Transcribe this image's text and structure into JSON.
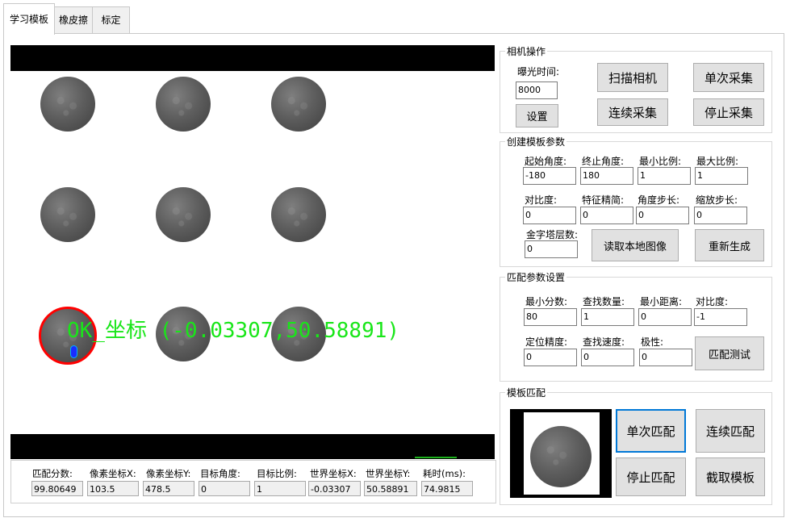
{
  "tabs": [
    "学习模板",
    "橡皮擦",
    "标定"
  ],
  "overlay": {
    "text": "OK_坐标 (-0.03307,50.58891)"
  },
  "results": {
    "labels": [
      "匹配分数:",
      "像素坐标X:",
      "像素坐标Y:",
      "目标角度:",
      "目标比例:",
      "世界坐标X:",
      "世界坐标Y:",
      "耗时(ms):"
    ],
    "values": [
      "99.80649",
      "103.5",
      "478.5",
      "0",
      "1",
      "-0.03307",
      "50.58891",
      "74.9815"
    ]
  },
  "camera": {
    "title": "相机操作",
    "exposure_label": "曝光时间:",
    "exposure_value": "8000",
    "set_button": "设置",
    "scan_button": "扫描相机",
    "single_capture_button": "单次采集",
    "continuous_capture_button": "连续采集",
    "stop_capture_button": "停止采集"
  },
  "create_template": {
    "title": "创建模板参数",
    "labels": [
      "起始角度:",
      "终止角度:",
      "最小比例:",
      "最大比例:",
      "对比度:",
      "特征精简:",
      "角度步长:",
      "缩放步长:",
      "金字塔层数:"
    ],
    "values": [
      "-180",
      "180",
      "1",
      "1",
      "0",
      "0",
      "0",
      "0",
      "0"
    ],
    "read_image_button": "读取本地图像",
    "regenerate_button": "重新生成"
  },
  "match_params": {
    "title": "匹配参数设置",
    "labels": [
      "最小分数:",
      "查找数量:",
      "最小距离:",
      "对比度:",
      "定位精度:",
      "查找速度:",
      "极性:"
    ],
    "values": [
      "80",
      "1",
      "0",
      "-1",
      "0",
      "0",
      "0"
    ],
    "test_button": "匹配测试"
  },
  "template_match": {
    "title": "模板匹配",
    "single_match_button": "单次匹配",
    "continuous_match_button": "连续匹配",
    "stop_match_button": "停止匹配",
    "capture_template_button": "截取模板"
  }
}
